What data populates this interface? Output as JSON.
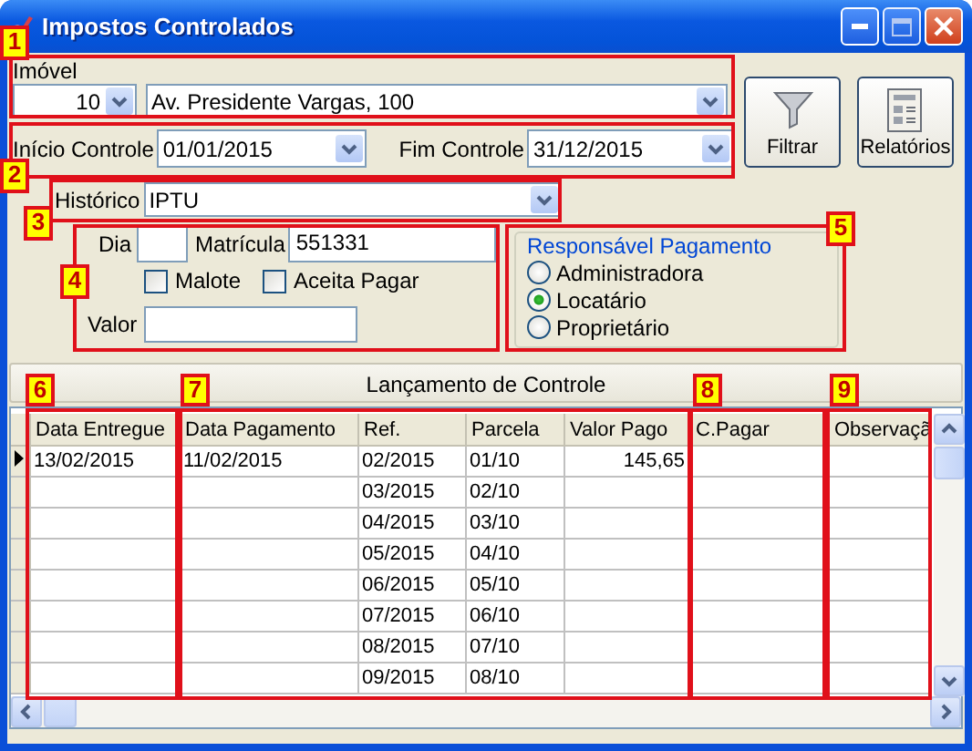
{
  "window": {
    "title": "Impostos Controlados"
  },
  "imovel": {
    "label": "Imóvel",
    "code": "10",
    "address": "Av. Presidente Vargas, 100"
  },
  "period": {
    "start_label": "Início Controle",
    "start": "01/01/2015",
    "end_label": "Fim Controle",
    "end": "31/12/2015"
  },
  "buttons": [
    {
      "label": "Filtrar",
      "kind": "filter"
    },
    {
      "label": "Relatórios",
      "kind": "report"
    }
  ],
  "historico": {
    "label": "Histórico",
    "value": "IPTU"
  },
  "details": {
    "dia_label": "Dia",
    "matricula_label": "Matrícula",
    "matricula": "551331",
    "valor_label": "Valor",
    "checks": [
      {
        "label": "Malote",
        "checked": false
      },
      {
        "label": "Aceita Pagar",
        "checked": false
      }
    ]
  },
  "responsavel": {
    "title": "Responsável Pagamento",
    "options": [
      {
        "label": "Administradora",
        "selected": false
      },
      {
        "label": "Locatário",
        "selected": true
      },
      {
        "label": "Proprietário",
        "selected": false
      }
    ]
  },
  "section_title": "Lançamento de Controle",
  "table": {
    "columns": [
      "Data Entregue",
      "Data Pagamento",
      "Ref.",
      "Parcela",
      "Valor Pago",
      "C.Pagar",
      "Observaçã"
    ],
    "rows": [
      {
        "current": true,
        "cells": [
          "13/02/2015",
          "11/02/2015",
          "02/2015",
          "01/10",
          "145,65",
          null,
          null
        ]
      },
      {
        "current": false,
        "cells": [
          null,
          null,
          "03/2015",
          "02/10",
          null,
          null,
          null
        ]
      },
      {
        "current": false,
        "cells": [
          null,
          null,
          "04/2015",
          "03/10",
          null,
          null,
          null
        ]
      },
      {
        "current": false,
        "cells": [
          null,
          null,
          "05/2015",
          "04/10",
          null,
          null,
          null
        ]
      },
      {
        "current": false,
        "cells": [
          null,
          null,
          "06/2015",
          "05/10",
          null,
          null,
          null
        ]
      },
      {
        "current": false,
        "cells": [
          null,
          null,
          "07/2015",
          "06/10",
          null,
          null,
          null
        ]
      },
      {
        "current": false,
        "cells": [
          null,
          null,
          "08/2015",
          "07/10",
          null,
          null,
          null
        ]
      },
      {
        "current": false,
        "cells": [
          null,
          null,
          "09/2015",
          "08/10",
          null,
          null,
          null
        ]
      }
    ]
  },
  "annotations": [
    "1",
    "2",
    "3",
    "4",
    "5",
    "6",
    "7",
    "8",
    "9"
  ]
}
